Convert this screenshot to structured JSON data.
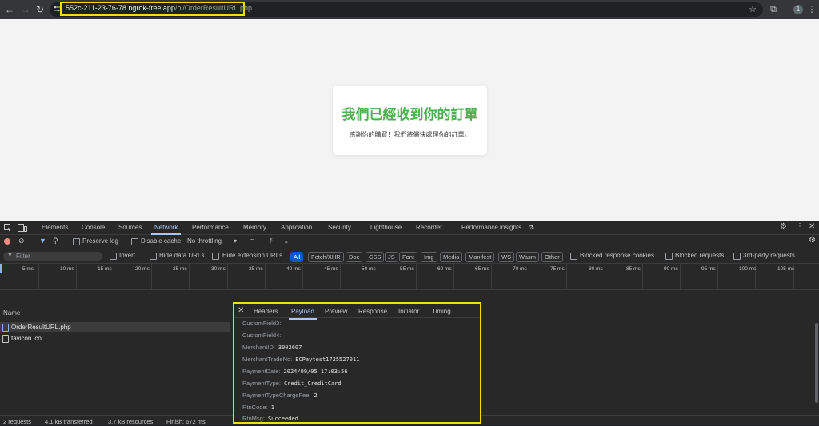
{
  "browser": {
    "url_host": "552c-211-23-76-78.ngrok-free.app",
    "url_path": "/hi/OrderResultURL.php",
    "avatar": "1"
  },
  "page": {
    "heading": "我們已經收到你的訂單",
    "message": "感謝你的購買！我們將儘快處理你的訂單。"
  },
  "devtools": {
    "tabs": [
      "Elements",
      "Console",
      "Sources",
      "Network",
      "Performance",
      "Memory",
      "Application",
      "Security",
      "Lighthouse",
      "Recorder",
      "Performance insights"
    ],
    "active_tab": "Network",
    "toolbar": {
      "preserve_log": "Preserve log",
      "disable_cache": "Disable cache",
      "throttling": "No throttling"
    },
    "filter": {
      "placeholder": "Filter",
      "invert": "Invert",
      "hide_data_urls": "Hide data URLs",
      "hide_extension_urls": "Hide extension URLs",
      "types": [
        "All",
        "Fetch/XHR",
        "Doc",
        "CSS",
        "JS",
        "Font",
        "Img",
        "Media",
        "Manifest",
        "WS",
        "Wasm",
        "Other"
      ],
      "blocked_cookies": "Blocked response cookies",
      "blocked_requests": "Blocked requests",
      "third_party": "3rd-party requests"
    },
    "timeline_ticks": [
      "5 ms",
      "10 ms",
      "15 ms",
      "20 ms",
      "25 ms",
      "30 ms",
      "35 ms",
      "40 ms",
      "45 ms",
      "50 ms",
      "55 ms",
      "60 ms",
      "65 ms",
      "70 ms",
      "75 ms",
      "80 ms",
      "85 ms",
      "90 ms",
      "95 ms",
      "100 ms",
      "105 ms"
    ],
    "list": {
      "header": "Name",
      "requests": [
        "OrderResultURL.php",
        "favicon.ico"
      ]
    },
    "status": {
      "requests": "2 requests",
      "transferred": "4.1 kB transferred",
      "resources": "3.7 kB resources",
      "finish": "Finish: 672 ms"
    },
    "payload": {
      "tabs": [
        "Headers",
        "Payload",
        "Preview",
        "Response",
        "Initiator",
        "Timing"
      ],
      "active_tab": "Payload",
      "rows": [
        {
          "key": "CustomField3:",
          "value": ""
        },
        {
          "key": "CustomField4:",
          "value": ""
        },
        {
          "key": "MerchantID:",
          "value": "3002607"
        },
        {
          "key": "MerchantTradeNo:",
          "value": "ECPaytest1725527011"
        },
        {
          "key": "PaymentDate:",
          "value": "2024/09/05 17:03:56"
        },
        {
          "key": "PaymentType:",
          "value": "Credit_CreditCard"
        },
        {
          "key": "PaymentTypeChargeFee:",
          "value": "2"
        },
        {
          "key": "RtnCode:",
          "value": "1"
        },
        {
          "key": "RtnMsg:",
          "value": "Succeeded"
        }
      ]
    }
  }
}
